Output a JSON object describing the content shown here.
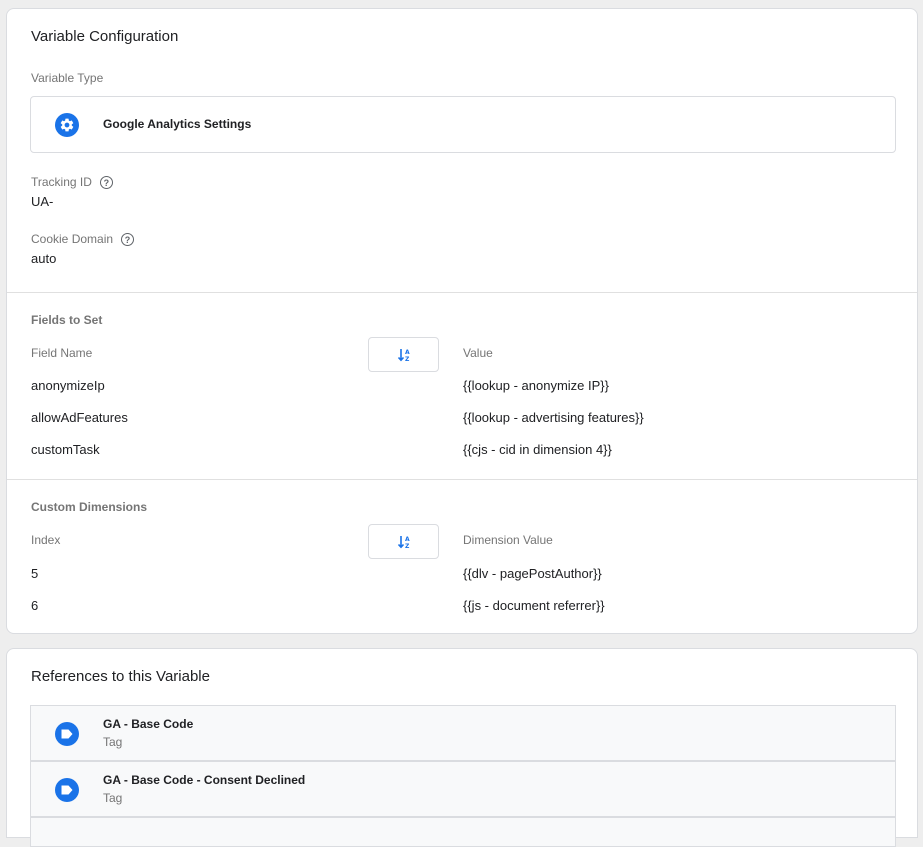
{
  "config": {
    "title": "Variable Configuration",
    "variable_type_label": "Variable Type",
    "variable_type_value": "Google Analytics Settings",
    "variable_type_icon": "gear-icon",
    "tracking_id_label": "Tracking ID",
    "tracking_id_value": "UA-",
    "cookie_domain_label": "Cookie Domain",
    "cookie_domain_value": "auto",
    "help_icon": "help-circle-icon"
  },
  "fields_to_set": {
    "title": "Fields to Set",
    "col_name": "Field Name",
    "col_value": "Value",
    "sort_icon": "sort-icon",
    "rows": [
      {
        "name": "anonymizeIp",
        "value": "{{lookup - anonymize IP}}"
      },
      {
        "name": "allowAdFeatures",
        "value": "{{lookup - advertising features}}"
      },
      {
        "name": "customTask",
        "value": "{{cjs - cid in dimension 4}}"
      }
    ]
  },
  "custom_dimensions": {
    "title": "Custom Dimensions",
    "col_index": "Index",
    "col_value": "Dimension Value",
    "sort_icon": "sort-icon",
    "rows": [
      {
        "index": "5",
        "value": "{{dlv - pagePostAuthor}}"
      },
      {
        "index": "6",
        "value": "{{js - document referrer}}"
      }
    ]
  },
  "references": {
    "title": "References to this Variable",
    "items": [
      {
        "name": "GA - Base Code",
        "type": "Tag",
        "icon": "tag-icon"
      },
      {
        "name": "GA - Base Code - Consent Declined",
        "type": "Tag",
        "icon": "tag-icon"
      }
    ]
  },
  "colors": {
    "accent": "#1a73e8",
    "background": "#eeeeee",
    "card": "#ffffff"
  }
}
